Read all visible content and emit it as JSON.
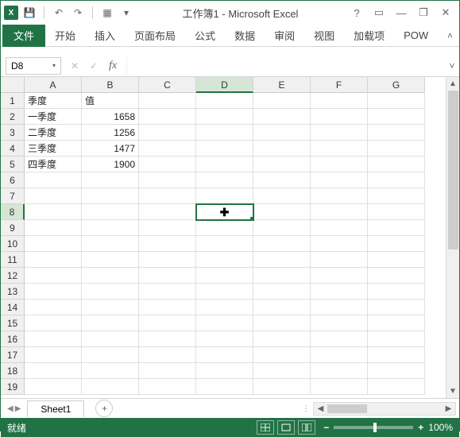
{
  "app_title": "工作簿1 - Microsoft Excel",
  "qat": {
    "save": "💾",
    "undo": "↶",
    "redo": "↷",
    "customize": "▾"
  },
  "win": {
    "help": "?",
    "ribbon_opts": "▭",
    "min": "—",
    "restore": "❐",
    "close": "✕"
  },
  "tabs": {
    "file": "文件",
    "home": "开始",
    "insert": "插入",
    "page_layout": "页面布局",
    "formulas": "公式",
    "data": "数据",
    "review": "审阅",
    "view": "视图",
    "addins": "加载项",
    "pow": "POW"
  },
  "collapse_icon": "˄",
  "namebox": {
    "value": "D8",
    "dropdown": "▾"
  },
  "formula_buttons": {
    "cancel": "✕",
    "confirm": "✓",
    "fx": "fx"
  },
  "formula_value": "",
  "expand_icon": "˅",
  "columns": [
    "A",
    "B",
    "C",
    "D",
    "E",
    "F",
    "G"
  ],
  "rows": [
    "1",
    "2",
    "3",
    "4",
    "5",
    "6",
    "7",
    "8",
    "9",
    "10",
    "11",
    "12",
    "13",
    "14",
    "15",
    "16",
    "17",
    "18",
    "19"
  ],
  "active_col": 3,
  "active_row": 7,
  "cell_data": {
    "0": {
      "0": "季度",
      "1": "值"
    },
    "1": {
      "0": "一季度",
      "1_num": "1658"
    },
    "2": {
      "0": "二季度",
      "1_num": "1256"
    },
    "3": {
      "0": "三季度",
      "1_num": "1477"
    },
    "4": {
      "0": "四季度",
      "1_num": "1900"
    }
  },
  "cursor_symbol": "✚",
  "sheet": {
    "tab": "Sheet1",
    "add": "+"
  },
  "vscroll": {
    "up": "▲",
    "down": "▼"
  },
  "hscroll": {
    "left": "◀",
    "right": "▶"
  },
  "status": {
    "ready": "就绪",
    "zoom_out": "−",
    "zoom_in": "+",
    "zoom_label": "100%"
  }
}
